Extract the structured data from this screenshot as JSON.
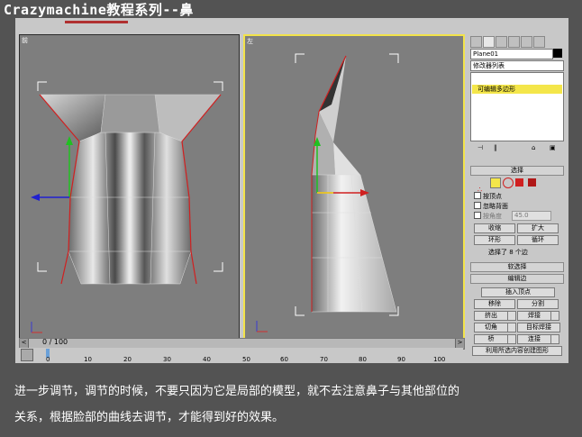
{
  "title": "Crazymachine教程系列--鼻",
  "viewports": {
    "front_label": "前",
    "left_label": "左"
  },
  "panel": {
    "object_name": "Plane01",
    "modifier_list": "修改器列表",
    "stack_item": "可编辑多边形",
    "selection_header": "选择",
    "by_vertex": "按顶点",
    "ignore_backfacing": "忽略背面",
    "by_angle": "按角度",
    "angle_value": "45.0",
    "shrink": "收缩",
    "grow": "扩大",
    "ring": "环形",
    "loop": "循环",
    "selection_status": "选择了 8 个边",
    "soft_selection_header": "软选择",
    "edit_edges_header": "编辑边",
    "insert_vertex": "插入顶点",
    "remove": "移除",
    "split": "分割",
    "extrude": "挤出",
    "weld": "焊接",
    "chamfer": "切角",
    "target_weld": "目标焊接",
    "bridge": "桥",
    "connect": "连接",
    "create_shape": "利用所选内容创建图形"
  },
  "timeline": {
    "frame_counter": "0 / 100",
    "ticks": [
      "0",
      "10",
      "20",
      "30",
      "40",
      "50",
      "60",
      "70",
      "80",
      "90",
      "100"
    ]
  },
  "caption": {
    "line1": "进一步调节，调节的时候，不要只因为它是局部的模型，就不去注意鼻子与其他部位的",
    "line2": "关系，根据脸部的曲线去调节，才能得到好的效果。"
  }
}
